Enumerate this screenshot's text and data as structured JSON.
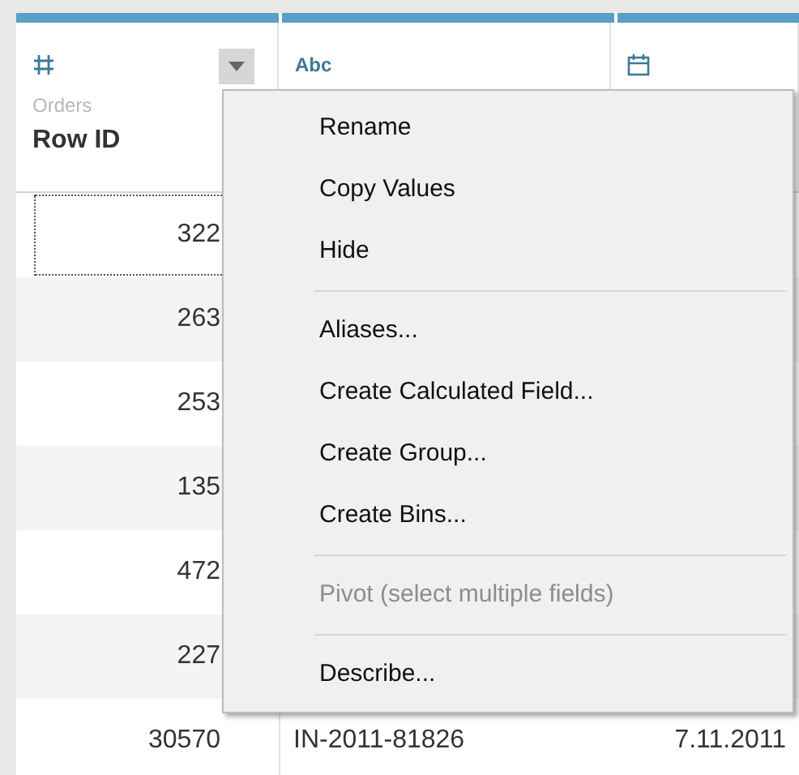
{
  "columns": [
    {
      "kind": "number",
      "source": "Orders",
      "name": "Row ID"
    },
    {
      "kind": "string",
      "type_label": "Abc"
    },
    {
      "kind": "date"
    }
  ],
  "rows": [
    {
      "selected": true,
      "cells": [
        "322"
      ]
    },
    {
      "selected": false,
      "cells": [
        "263"
      ]
    },
    {
      "selected": false,
      "cells": [
        "253"
      ]
    },
    {
      "selected": false,
      "cells": [
        "135"
      ]
    },
    {
      "selected": false,
      "cells": [
        "472"
      ]
    },
    {
      "selected": false,
      "cells": [
        "227"
      ]
    },
    {
      "selected": false,
      "cells": [
        "30570",
        "IN-2011-81826",
        "7.11.2011"
      ]
    }
  ],
  "context_menu": {
    "open": true,
    "items": [
      {
        "kind": "item",
        "label": "Rename",
        "disabled": false
      },
      {
        "kind": "item",
        "label": "Copy Values",
        "disabled": false
      },
      {
        "kind": "item",
        "label": "Hide",
        "disabled": false
      },
      {
        "kind": "separator"
      },
      {
        "kind": "item",
        "label": "Aliases...",
        "disabled": false
      },
      {
        "kind": "item",
        "label": "Create Calculated Field...",
        "disabled": false
      },
      {
        "kind": "item",
        "label": "Create Group...",
        "disabled": false
      },
      {
        "kind": "item",
        "label": "Create Bins...",
        "disabled": false
      },
      {
        "kind": "separator"
      },
      {
        "kind": "item",
        "label": "Pivot (select multiple fields)",
        "disabled": true
      },
      {
        "kind": "separator"
      },
      {
        "kind": "item",
        "label": "Describe...",
        "disabled": false
      }
    ]
  }
}
